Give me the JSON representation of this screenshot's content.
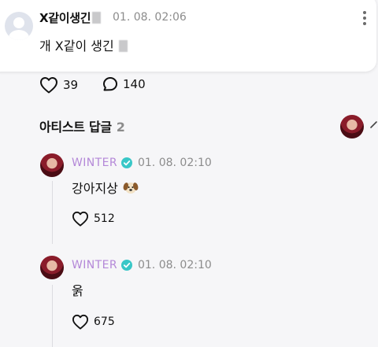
{
  "top_comment": {
    "author": "X같이생긴",
    "date": "01. 08. 02:06",
    "text": "개 X같이 생긴",
    "likes": "39",
    "replies": "140"
  },
  "artist_section": {
    "title": "아티스트 답글",
    "count": "2"
  },
  "artist_replies": [
    {
      "author": "WINTER",
      "date": "01. 08. 02:10",
      "text": "강아지상",
      "likes": "512"
    },
    {
      "author": "WINTER",
      "date": "01. 08. 02:10",
      "text": "욹",
      "likes": "675"
    }
  ],
  "colors": {
    "artist_name": "#b488d8",
    "verified_badge": "#39c7c7",
    "background": "#f6f6f8"
  }
}
